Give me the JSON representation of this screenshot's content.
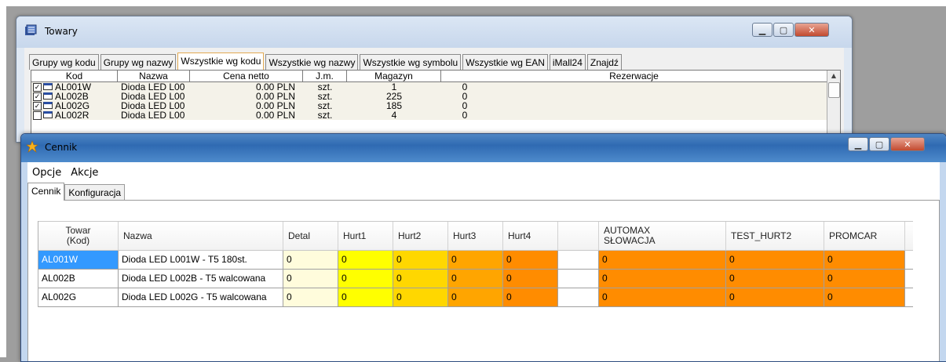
{
  "towary": {
    "title": "Towary",
    "tabs": [
      {
        "label": "Grupy wg kodu"
      },
      {
        "label": "Grupy wg nazwy"
      },
      {
        "label": "Wszystkie wg kodu"
      },
      {
        "label": "Wszystkie wg nazwy"
      },
      {
        "label": "Wszystkie wg symbolu"
      },
      {
        "label": "Wszystkie wg EAN"
      },
      {
        "label": "iMall24"
      },
      {
        "label": "Znajdź"
      }
    ],
    "columns": {
      "kod": "Kod",
      "nazwa": "Nazwa",
      "cena": "Cena netto",
      "jm": "J.m.",
      "magazyn": "Magazyn",
      "rezerwacje": "Rezerwacje"
    },
    "rows": [
      {
        "checked": "✓",
        "kod": "AL001W",
        "nazwa": "Dioda LED L00",
        "cena": "0.00 PLN",
        "jm": "szt.",
        "magazyn": "1",
        "rezerwacje": "0"
      },
      {
        "checked": "✓",
        "kod": "AL002B",
        "nazwa": "Dioda LED L00",
        "cena": "0.00 PLN",
        "jm": "szt.",
        "magazyn": "225",
        "rezerwacje": "0"
      },
      {
        "checked": "✓",
        "kod": "AL002G",
        "nazwa": "Dioda LED L00",
        "cena": "0.00 PLN",
        "jm": "szt.",
        "magazyn": "185",
        "rezerwacje": "0"
      },
      {
        "checked": "",
        "kod": "AL002R",
        "nazwa": "Dioda LED L00",
        "cena": "0.00 PLN",
        "jm": "szt.",
        "magazyn": "4",
        "rezerwacje": "0"
      }
    ]
  },
  "cennik": {
    "title": "Cennik",
    "menu": {
      "opcje": "Opcje",
      "akcje": "Akcje"
    },
    "tabs": {
      "cennik": "Cennik",
      "konfiguracja": "Konfiguracja"
    },
    "columns": {
      "towar_line1": "Towar",
      "towar_line2": "(Kod)",
      "nazwa": "Nazwa",
      "detal": "Detal",
      "hurt1": "Hurt1",
      "hurt2": "Hurt2",
      "hurt3": "Hurt3",
      "hurt4": "Hurt4",
      "gap": "",
      "automax_line1": "AUTOMAX",
      "automax_line2": "SŁOWACJA",
      "test_hurt2": "TEST_HURT2",
      "promcar": "PROMCAR"
    },
    "rows": [
      {
        "kod": "AL001W",
        "nazwa": "Dioda LED L001W - T5 180st.",
        "detal": "0",
        "hurt1": "0",
        "hurt2": "0",
        "hurt3": "0",
        "hurt4": "0",
        "automax": "0",
        "test_hurt2": "0",
        "promcar": "0"
      },
      {
        "kod": "AL002B",
        "nazwa": "Dioda LED L002B - T5 walcowana",
        "detal": "0",
        "hurt1": "0",
        "hurt2": "0",
        "hurt3": "0",
        "hurt4": "0",
        "automax": "0",
        "test_hurt2": "0",
        "promcar": "0"
      },
      {
        "kod": "AL002G",
        "nazwa": "Dioda LED L002G - T5 walcowana",
        "detal": "0",
        "hurt1": "0",
        "hurt2": "0",
        "hurt3": "0",
        "hurt4": "0",
        "automax": "0",
        "test_hurt2": "0",
        "promcar": "0"
      }
    ]
  },
  "colors": {
    "detal": "#fffcdc",
    "hurt1": "#ffff00",
    "hurt2": "#ffd700",
    "hurt3": "#ffa500",
    "hurt4_and_rest": "#ff8c00",
    "selection": "#3399ff"
  }
}
